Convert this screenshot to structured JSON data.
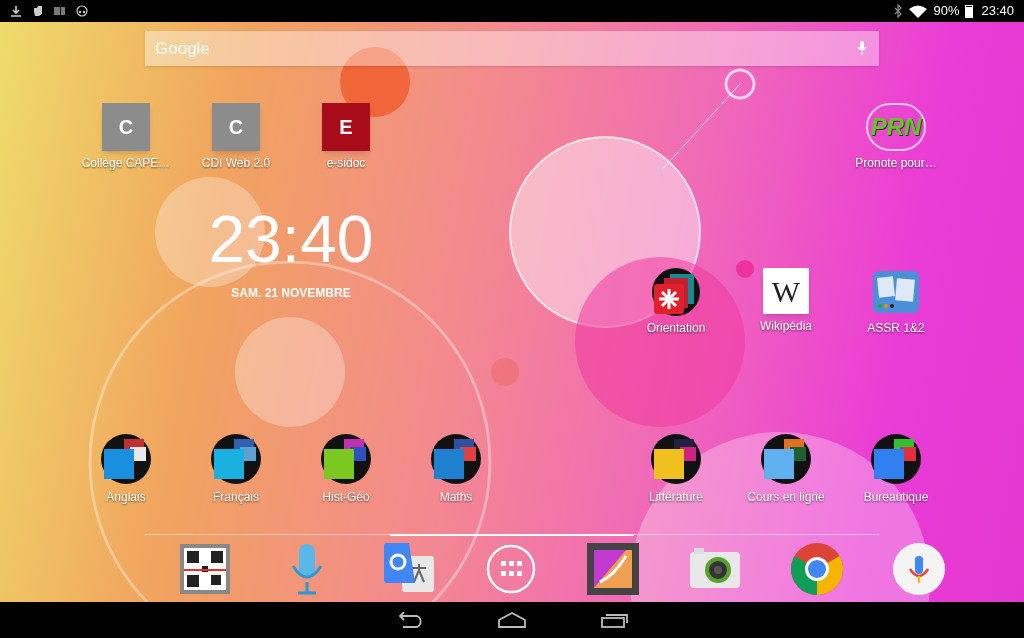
{
  "status_bar": {
    "battery": "90%",
    "time": "23:40"
  },
  "search": {
    "logo": "Google"
  },
  "apps": [
    {
      "kind": "letter",
      "letter": "C",
      "color": "#8c8c8c",
      "label": "Collège CAPE…"
    },
    {
      "kind": "letter",
      "letter": "C",
      "color": "#8c8c8c",
      "label": "CDI Web 2.0"
    },
    {
      "kind": "letter",
      "letter": "E",
      "color": "#a80c1a",
      "label": "e-sidoc"
    },
    {
      "kind": "logo",
      "logo": "PRN",
      "label": "Pronote pour…"
    },
    {
      "kind": "drawn",
      "label": "Orientation"
    },
    {
      "kind": "logo",
      "logo": "W",
      "label": "Wikipédia"
    },
    {
      "kind": "drawn",
      "label": "ASSR 1&2"
    },
    {
      "kind": "folder",
      "label": "Anglais"
    },
    {
      "kind": "folder",
      "label": "Français"
    },
    {
      "kind": "folder",
      "label": "Hist-Géo"
    },
    {
      "kind": "folder",
      "label": "Maths"
    },
    {
      "kind": "folder",
      "label": "Littérature"
    },
    {
      "kind": "folder",
      "label": "Cours en ligne"
    },
    {
      "kind": "folder",
      "label": "Bureautique"
    }
  ],
  "clock": {
    "time": "23:40",
    "date": "SAM. 21 NOVEMBRE"
  },
  "pages": [
    {
      "selected": false
    },
    {
      "selected": true
    },
    {
      "selected": false
    }
  ]
}
